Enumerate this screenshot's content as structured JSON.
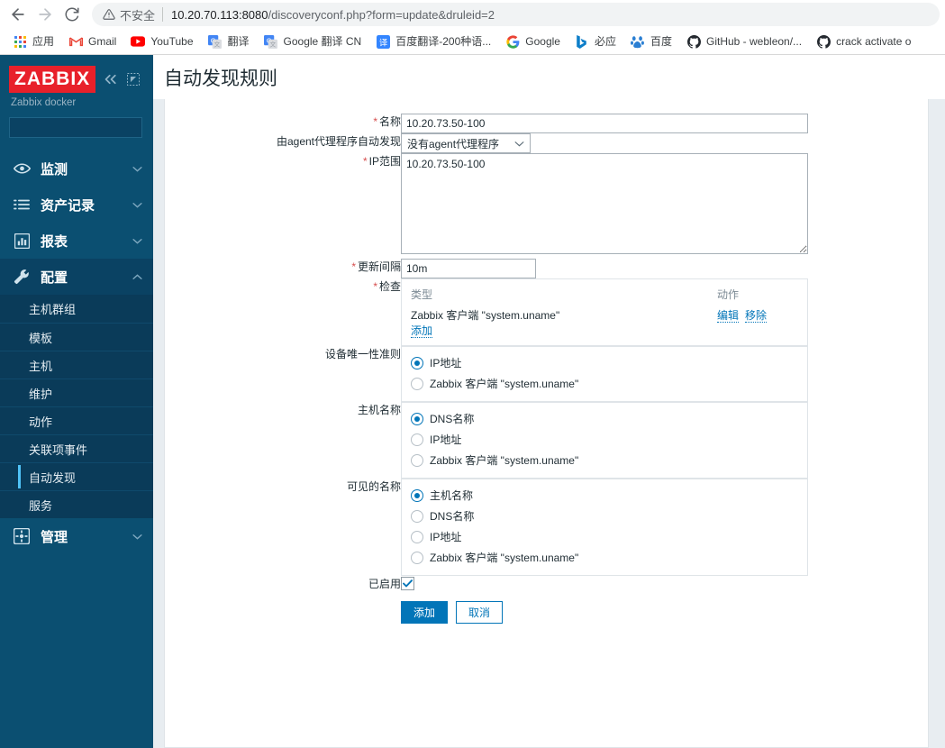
{
  "browser": {
    "back_icon": "back-arrow-icon",
    "forward_icon": "forward-arrow-icon",
    "reload_icon": "reload-icon",
    "security_warning": "不安全",
    "url_host": "10.20.70.113:8080",
    "url_path": "/discoveryconf.php?form=update&druleid=2",
    "bookmarks": [
      {
        "label": "应用",
        "icon": "apps-grid-icon"
      },
      {
        "label": "Gmail",
        "icon": "gmail-icon"
      },
      {
        "label": "YouTube",
        "icon": "youtube-icon"
      },
      {
        "label": "翻译",
        "icon": "google-translate-icon"
      },
      {
        "label": "Google 翻译 CN",
        "icon": "google-translate-icon"
      },
      {
        "label": "百度翻译-200种语...",
        "icon": "baidu-translate-icon"
      },
      {
        "label": "Google",
        "icon": "google-icon"
      },
      {
        "label": "必应",
        "icon": "bing-icon"
      },
      {
        "label": "百度",
        "icon": "baidu-icon"
      },
      {
        "label": "GitHub - webleon/...",
        "icon": "github-icon"
      },
      {
        "label": "crack activate o",
        "icon": "github-icon"
      }
    ]
  },
  "sidebar": {
    "logo_text": "ZABBIX",
    "server_name": "Zabbix docker",
    "collapse_icon": "double-chevron-left-icon",
    "hide_icon": "collapse-panel-icon",
    "search_placeholder": "",
    "search_value": "",
    "search_icon": "search-icon",
    "groups": [
      {
        "label": "监测",
        "icon": "eye-icon",
        "expanded": false
      },
      {
        "label": "资产记录",
        "icon": "list-icon",
        "expanded": false
      },
      {
        "label": "报表",
        "icon": "bar-chart-icon",
        "expanded": false
      },
      {
        "label": "配置",
        "icon": "wrench-icon",
        "expanded": true
      },
      {
        "label": "管理",
        "icon": "gear-icon",
        "expanded": false
      }
    ],
    "config_items": [
      {
        "label": "主机群组",
        "selected": false
      },
      {
        "label": "模板",
        "selected": false
      },
      {
        "label": "主机",
        "selected": false
      },
      {
        "label": "维护",
        "selected": false
      },
      {
        "label": "动作",
        "selected": false
      },
      {
        "label": "关联项事件",
        "selected": false
      },
      {
        "label": "自动发现",
        "selected": true
      },
      {
        "label": "服务",
        "selected": false
      }
    ]
  },
  "page": {
    "title": "自动发现规则"
  },
  "form": {
    "name_label": "名称",
    "name_value": "10.20.73.50-100",
    "proxy_label": "由agent代理程序自动发现",
    "proxy_value": "没有agent代理程序",
    "iprange_label": "IP范围",
    "iprange_value": "10.20.73.50-100",
    "interval_label": "更新间隔",
    "interval_value": "10m",
    "checks_label": "检查",
    "checks_col_type": "类型",
    "checks_col_action": "动作",
    "checks_rows": [
      {
        "type": "Zabbix 客户端 \"system.uname\"",
        "edit": "编辑",
        "remove": "移除"
      }
    ],
    "checks_add": "添加",
    "uniqueness_label": "设备唯一性准则",
    "uniqueness_options": [
      {
        "label": "IP地址",
        "selected": true
      },
      {
        "label": "Zabbix 客户端 \"system.uname\"",
        "selected": false
      }
    ],
    "hostname_label": "主机名称",
    "hostname_options": [
      {
        "label": "DNS名称",
        "selected": true
      },
      {
        "label": "IP地址",
        "selected": false
      },
      {
        "label": "Zabbix 客户端 \"system.uname\"",
        "selected": false
      }
    ],
    "visiblename_label": "可见的名称",
    "visiblename_options": [
      {
        "label": "主机名称",
        "selected": true
      },
      {
        "label": "DNS名称",
        "selected": false
      },
      {
        "label": "IP地址",
        "selected": false
      },
      {
        "label": "Zabbix 客户端 \"system.uname\"",
        "selected": false
      }
    ],
    "enabled_label": "已启用",
    "enabled_checked": true,
    "submit_label": "添加",
    "cancel_label": "取消"
  },
  "colors": {
    "zabbix_sidebar": "#0b4f71",
    "zabbix_logo_red": "#e8202a",
    "accent_blue": "#0275b8",
    "selected_bar": "#4fc3f7",
    "page_bg": "#e8edf1",
    "required_star": "#d64e4e"
  }
}
